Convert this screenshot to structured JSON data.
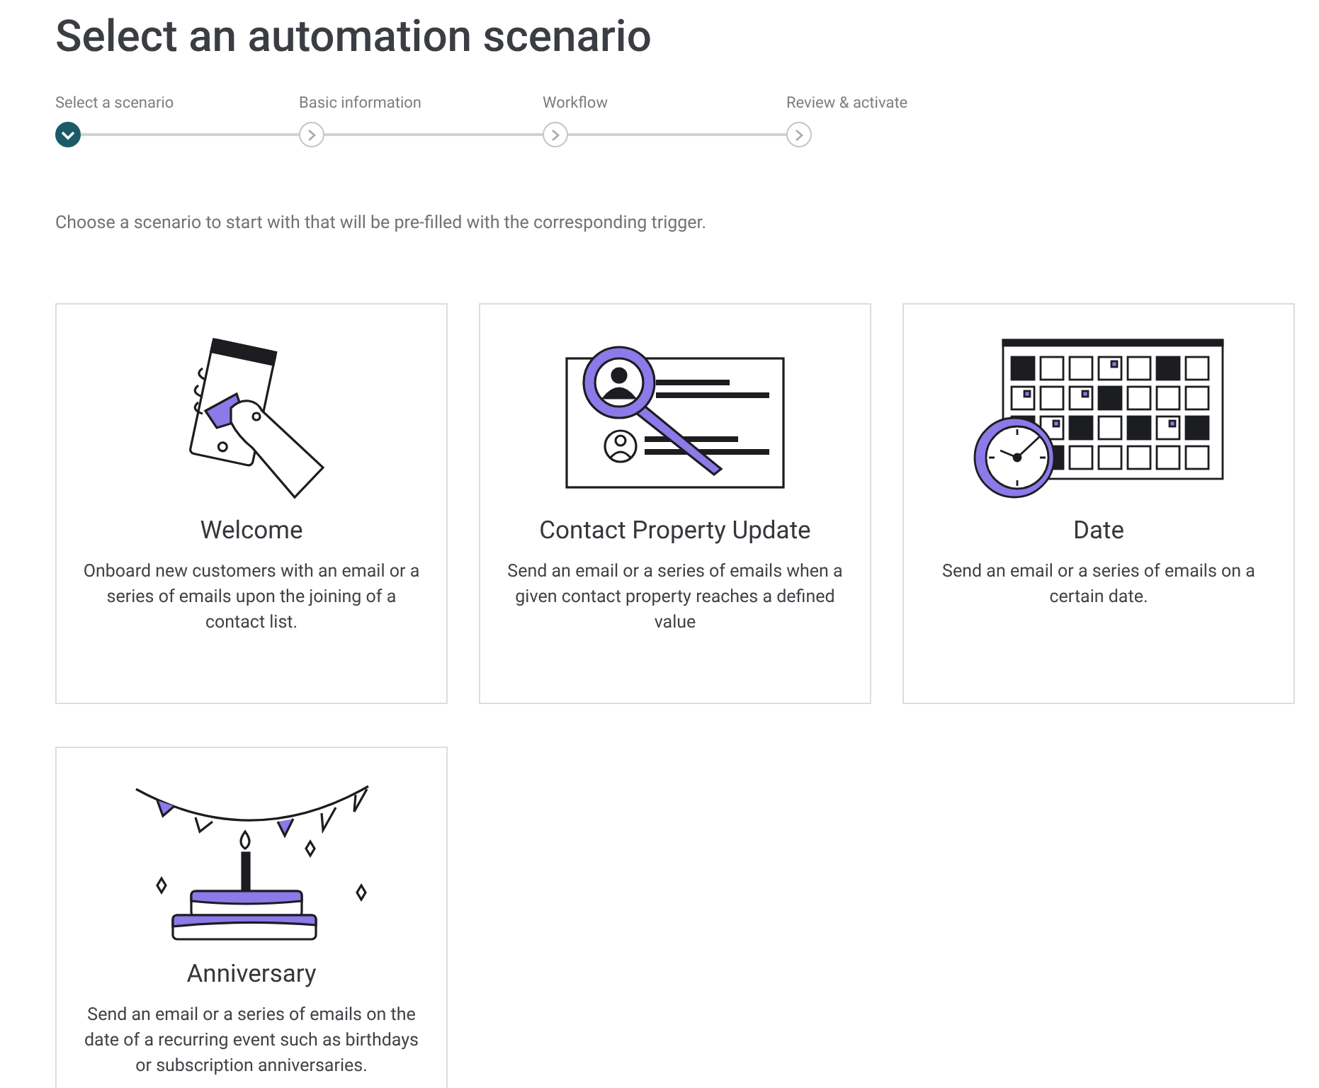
{
  "title": "Select an automation scenario",
  "steps": [
    {
      "label": "Select a scenario",
      "completed": true
    },
    {
      "label": "Basic information",
      "completed": false
    },
    {
      "label": "Workflow",
      "completed": false
    },
    {
      "label": "Review & activate",
      "completed": false
    }
  ],
  "intro": "Choose a scenario to start with that will be pre-filled with the corresponding trigger.",
  "scenarios": [
    {
      "kind": "welcome",
      "title": "Welcome",
      "description": "Onboard new customers with an email or a series of emails upon the joining of a contact list."
    },
    {
      "kind": "property",
      "title": "Contact Property Update",
      "description": "Send an email or a series of emails when a given contact property reaches a defined value"
    },
    {
      "kind": "date",
      "title": "Date",
      "description": "Send an email or a series of emails on a certain date."
    },
    {
      "kind": "anniversary",
      "title": "Anniversary",
      "description": "Send an email or a series of emails on the date of a recurring event such as birthdays or subscription anniversaries."
    }
  ]
}
